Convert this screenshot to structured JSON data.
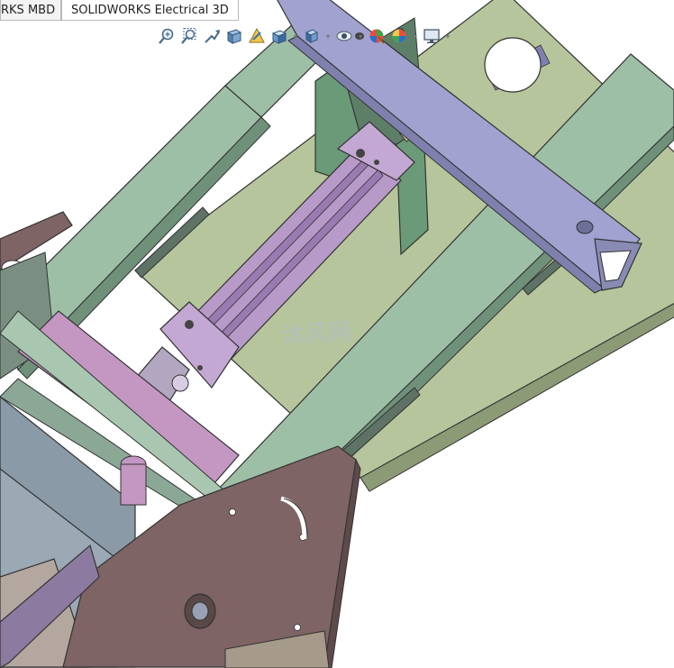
{
  "tabs": {
    "mbd_label": "RKS MBD",
    "electrical_label": "SOLIDWORKS Electrical 3D"
  },
  "toolbar": {
    "icons": [
      "zoom-to-fit-icon",
      "zoom-to-area-icon",
      "previous-view-icon",
      "section-view-icon",
      "dynamic-annotation-views-icon",
      "view-orientation-icon",
      "display-style-icon",
      "hide-show-items-icon",
      "edit-appearance-icon",
      "apply-scene-icon",
      "view-settings-icon"
    ]
  },
  "watermark": {
    "text": "沐风网"
  },
  "colors": {
    "frame_green": "#9dbfa6",
    "frame_green_dark": "#6f917a",
    "plate_olive": "#b6c59b",
    "beam_lavender": "#a1a2cf",
    "cylinder_purple": "#b89ac8",
    "bracket_brown": "#7e6464",
    "base_steel": "#8a9aa6"
  }
}
